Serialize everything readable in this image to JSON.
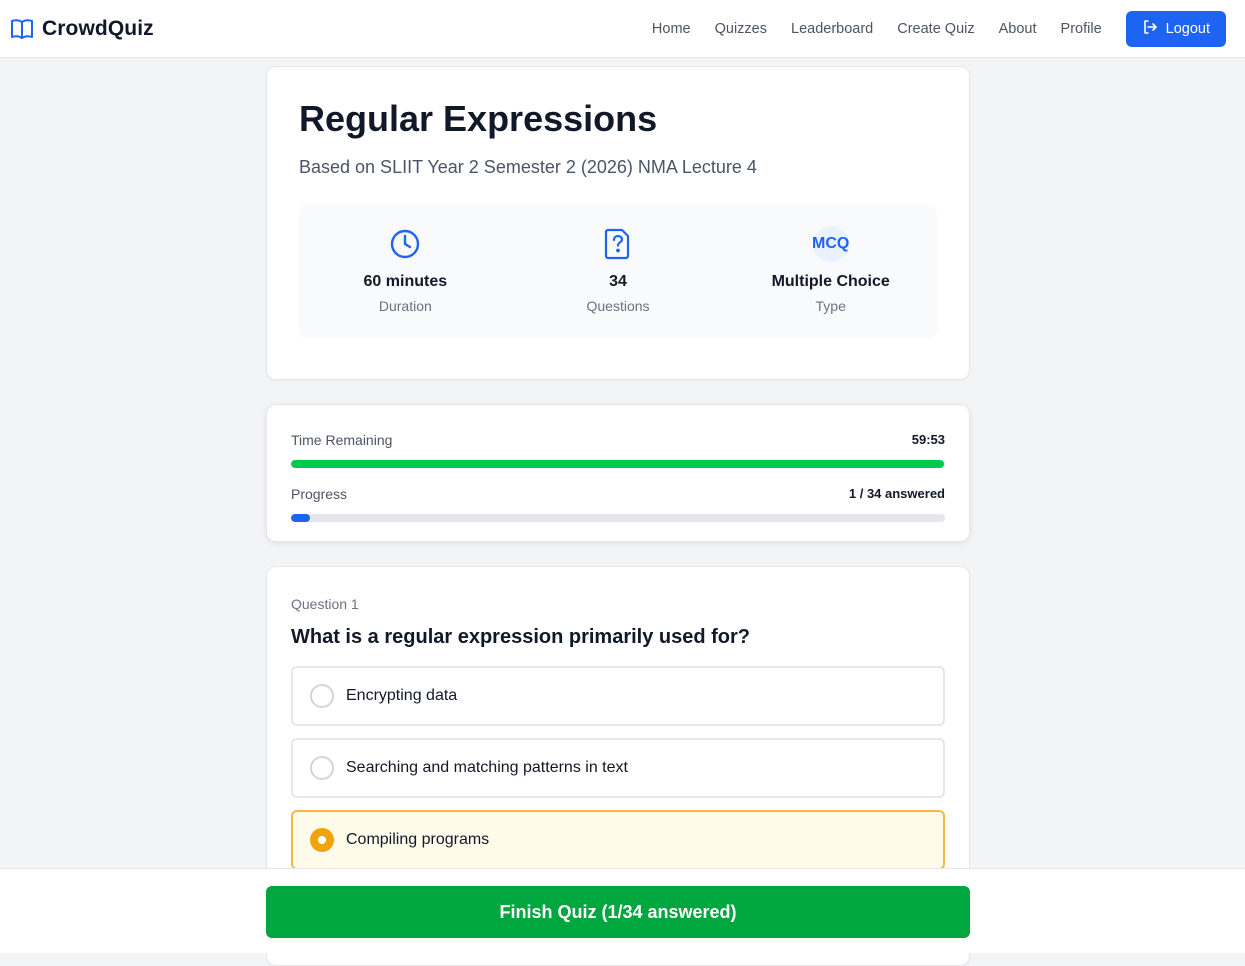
{
  "navbar": {
    "brand": "CrowdQuiz",
    "links": [
      "Home",
      "Quizzes",
      "Leaderboard",
      "Create Quiz",
      "About",
      "Profile"
    ],
    "logout_label": "Logout",
    "accent_color": "#1d64f2"
  },
  "quiz": {
    "title": "Regular Expressions",
    "subtitle": "Based on SLIIT Year 2 Semester 2 (2026) NMA Lecture 4",
    "stats": [
      {
        "icon": "clock-icon",
        "value": "60 minutes",
        "label": "Duration"
      },
      {
        "icon": "question-file-icon",
        "value": "34",
        "label": "Questions"
      },
      {
        "icon": "mcq-badge",
        "badge": "MCQ",
        "value": "Multiple Choice",
        "label": "Type"
      }
    ]
  },
  "status": {
    "time_label": "Time Remaining",
    "time_value": "59:53",
    "time_fraction": 0.9986,
    "time_color": "#00c950",
    "progress_label": "Progress",
    "progress_value": "1 / 34 answered",
    "progress_fraction": 0.0294,
    "progress_color": "#1d64f2"
  },
  "question": {
    "number_label": "Question 1",
    "text": "What is a regular expression primarily used for?",
    "options": [
      {
        "label": "Encrypting data",
        "selected": false
      },
      {
        "label": "Searching and matching patterns in text",
        "selected": false
      },
      {
        "label": "Compiling programs",
        "selected": true
      }
    ]
  },
  "footer": {
    "finish_label": "Finish Quiz (1/34 answered)",
    "finish_color": "#00a63e"
  }
}
